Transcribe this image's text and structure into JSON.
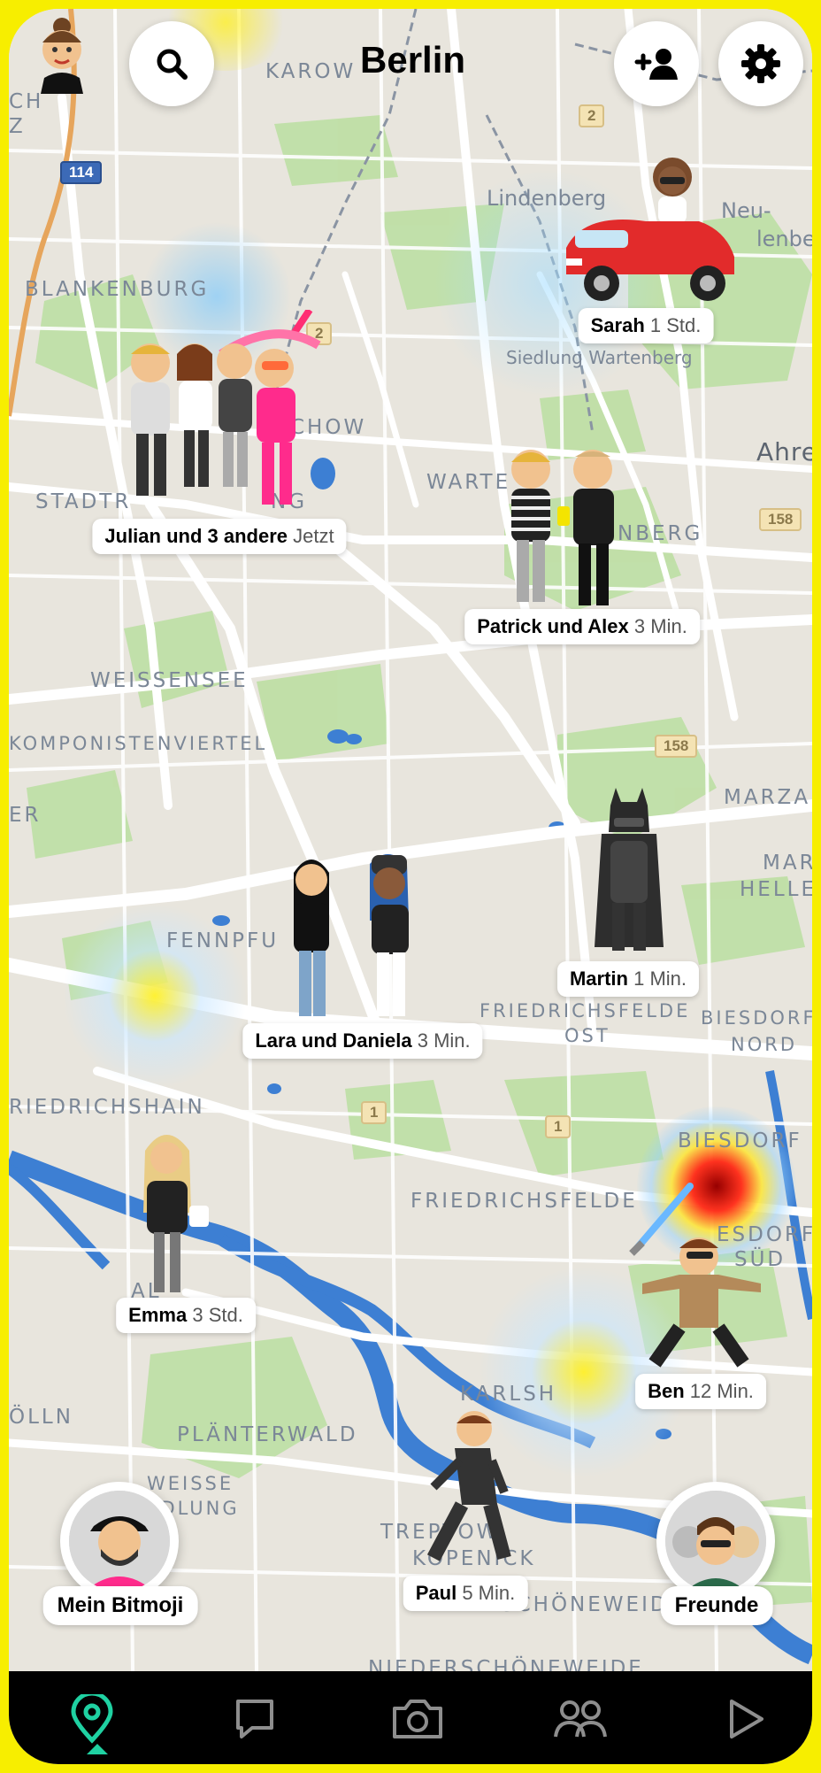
{
  "header": {
    "city": "Berlin",
    "search_icon": "search-icon",
    "add_friend_icon": "add-friend-icon",
    "settings_icon": "gear-icon"
  },
  "map_labels": {
    "karow": "KAROW",
    "ch": "CH",
    "z": "Z",
    "lindenberg": "Lindenberg",
    "neu": "Neu-",
    "lindenberg2": "lenberg",
    "blankenburg": "BLANKENBURG",
    "siedlung": "Siedlung Wartenberg",
    "ahre": "Ahre",
    "stadtr": "STADTR",
    "ng": "NG",
    "chow": "CHOW",
    "warte": "WARTE",
    "nberg": "NBERG",
    "weissensee": "WEISSENSEE",
    "komponisten": "KOMPONISTENVIERTEL",
    "er": "ER",
    "marzah": "MARZAH",
    "marz": "MARZ",
    "helle": "HELLE",
    "fennpfuhl": "FENNPFU",
    "friedrichsfelde_ost": "FRIEDRICHSFELDE",
    "ost": "OST",
    "biesdorf_nord": "BIESDORF",
    "nord": "NORD",
    "friedrichshain": "RIEDRICHSHAIN",
    "biesdorf": "BIESDORF",
    "friedrichsfelde": "FRIEDRICHSFELDE",
    "biesdorf_sued": "ESDORF",
    "sued": "SÜD",
    "alt": "AL",
    "karlsh": "KARLSH",
    "kolln": "ÖLLN",
    "planterwald": "PLÄNTERWALD",
    "weisse": "WEISSE",
    "siedlung2": "IEDLUNG",
    "trep": "TREPTOW-",
    "kopenick": "KÖPENICK",
    "schoneweide": "SCHÖNEWEIDE",
    "niederschoneweide": "NIEDERSCHÖNEWEIDE"
  },
  "road_badges": [
    "114",
    "2",
    "2",
    "158",
    "158",
    "1",
    "1"
  ],
  "friends": [
    {
      "name": "Sarah",
      "time": "1 Std."
    },
    {
      "name": "Julian und 3 andere",
      "time": "Jetzt"
    },
    {
      "name": "Patrick und Alex",
      "time": "3 Min."
    },
    {
      "name": "Lara und Daniela",
      "time": "3 Min."
    },
    {
      "name": "Martin",
      "time": "1 Min."
    },
    {
      "name": "Emma",
      "time": "3 Std."
    },
    {
      "name": "Ben",
      "time": "12 Min."
    },
    {
      "name": "Paul",
      "time": "5 Min."
    }
  ],
  "bottom_buttons": {
    "my_bitmoji": "Mein Bitmoji",
    "friends": "Freunde"
  },
  "nav": {
    "items": [
      "map-pin-icon",
      "chat-icon",
      "camera-icon",
      "friends-icon",
      "stories-icon"
    ],
    "active": "map",
    "accent": "#1fd1a2"
  },
  "colors": {
    "frame": "#f7ee00",
    "water": "#3d7fd3",
    "park": "#b9dba0"
  }
}
